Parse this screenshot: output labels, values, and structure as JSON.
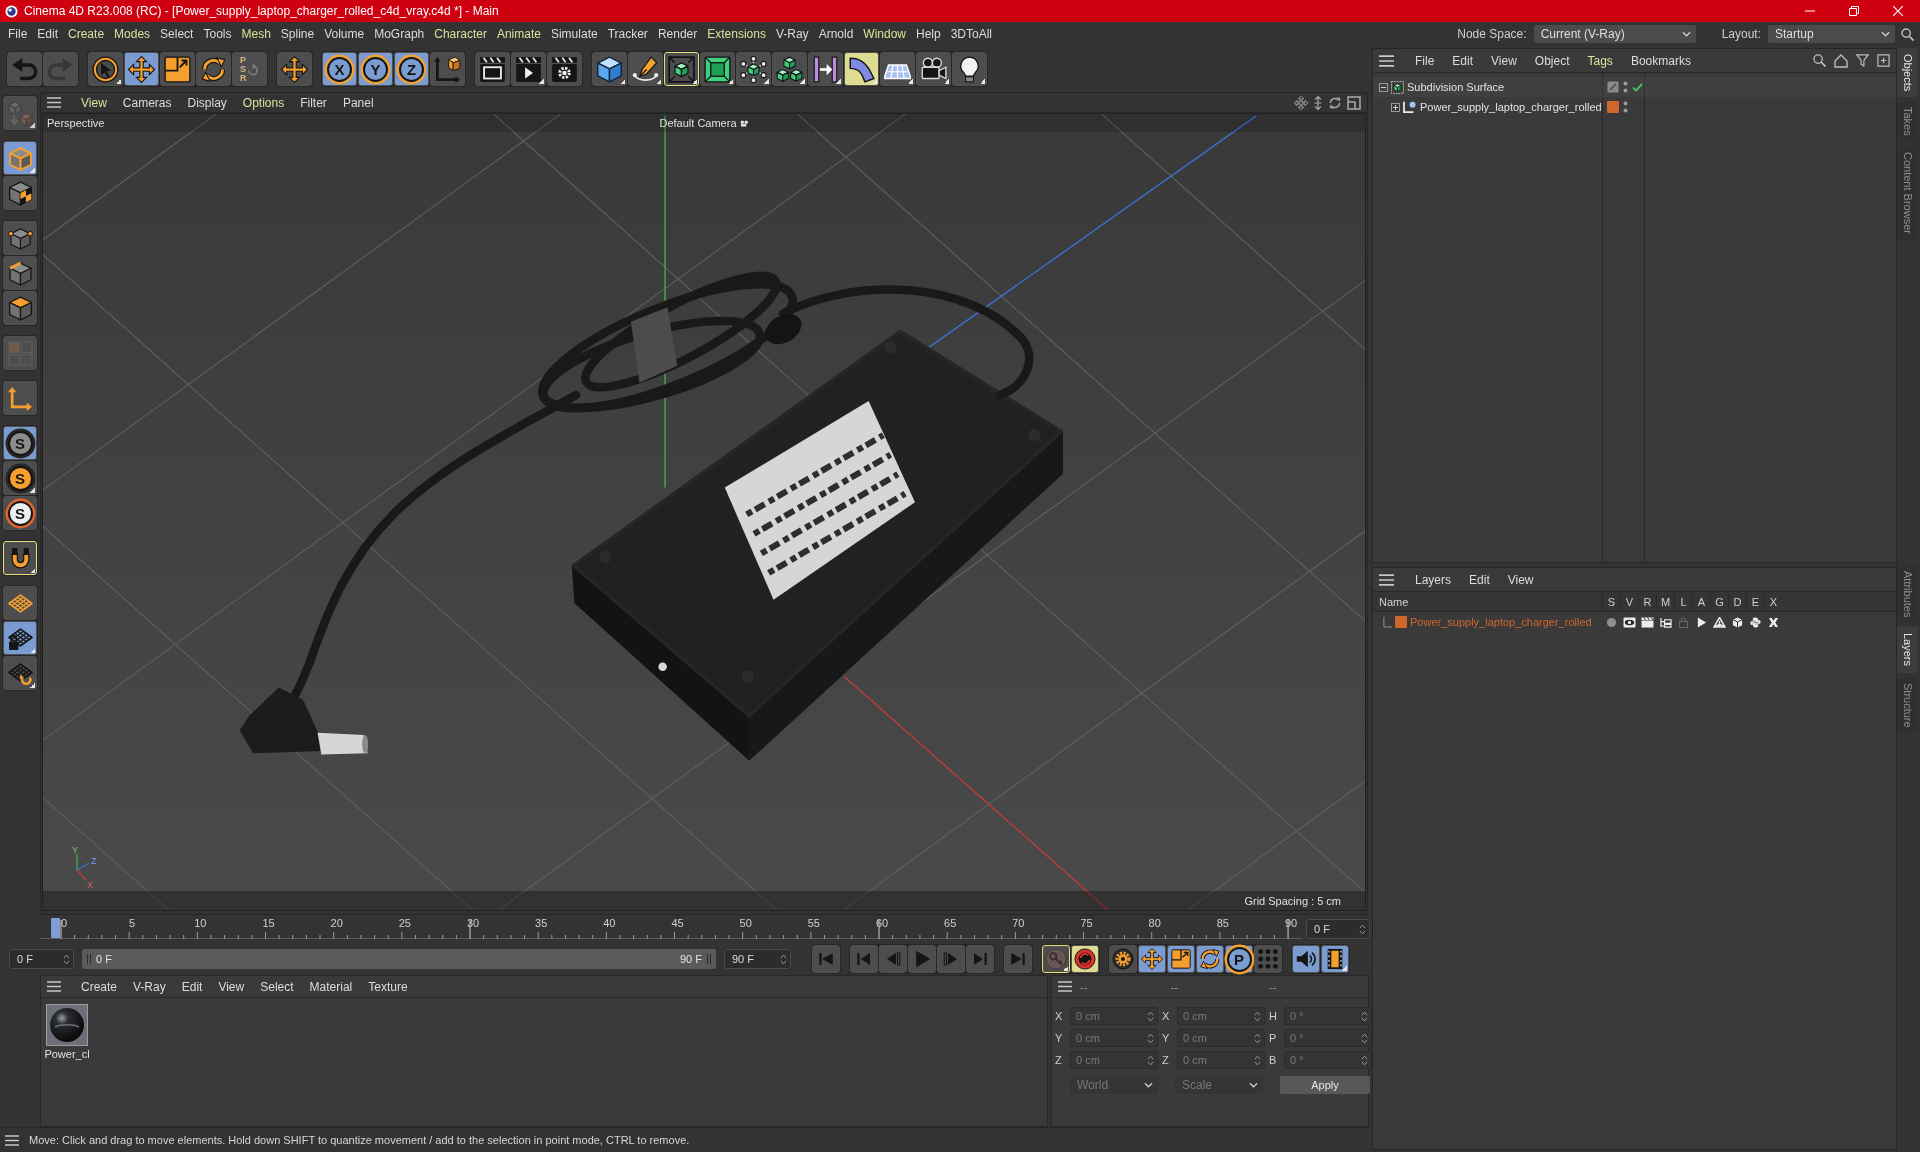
{
  "window": {
    "title": "Cinema 4D R23.008 (RC) - [Power_supply_laptop_charger_rolled_c4d_vray.c4d *] - Main"
  },
  "menu_bar": [
    {
      "label": "File",
      "highlighted": false
    },
    {
      "label": "Edit",
      "highlighted": false
    },
    {
      "label": "Create",
      "highlighted": true
    },
    {
      "label": "Modes",
      "highlighted": true
    },
    {
      "label": "Select",
      "highlighted": false
    },
    {
      "label": "Tools",
      "highlighted": false
    },
    {
      "label": "Mesh",
      "highlighted": true
    },
    {
      "label": "Spline",
      "highlighted": false
    },
    {
      "label": "Volume",
      "highlighted": false
    },
    {
      "label": "MoGraph",
      "highlighted": false
    },
    {
      "label": "Character",
      "highlighted": true
    },
    {
      "label": "Animate",
      "highlighted": true
    },
    {
      "label": "Simulate",
      "highlighted": false
    },
    {
      "label": "Tracker",
      "highlighted": false
    },
    {
      "label": "Render",
      "highlighted": false
    },
    {
      "label": "Extensions",
      "highlighted": true
    },
    {
      "label": "V-Ray",
      "highlighted": false
    },
    {
      "label": "Arnold",
      "highlighted": false
    },
    {
      "label": "Window",
      "highlighted": true
    },
    {
      "label": "Help",
      "highlighted": false
    },
    {
      "label": "3DToAll",
      "highlighted": false
    }
  ],
  "node_space": {
    "label": "Node Space:",
    "value": "Current (V-Ray)"
  },
  "layout": {
    "label": "Layout:",
    "value": "Startup"
  },
  "toolbar": [
    [
      {
        "kind": "undo",
        "selected": false,
        "highlighted": false,
        "lit": false,
        "disabled": false,
        "submenu": false
      },
      {
        "kind": "redo",
        "selected": false,
        "highlighted": false,
        "lit": false,
        "disabled": true,
        "submenu": false
      }
    ],
    [
      {
        "kind": "select",
        "selected": false,
        "highlighted": false,
        "lit": false,
        "disabled": false,
        "submenu": true
      },
      {
        "kind": "move",
        "selected": true,
        "highlighted": false,
        "lit": false,
        "disabled": false,
        "submenu": false
      },
      {
        "kind": "scale",
        "selected": false,
        "highlighted": false,
        "lit": false,
        "disabled": false,
        "submenu": false
      },
      {
        "kind": "rotate",
        "selected": false,
        "highlighted": false,
        "lit": false,
        "disabled": false,
        "submenu": false
      },
      {
        "kind": "psr",
        "glyph": "PSR",
        "selected": false,
        "highlighted": false,
        "lit": false,
        "disabled": true,
        "submenu": false
      }
    ],
    [
      {
        "kind": "transform",
        "selected": false,
        "highlighted": false,
        "lit": false,
        "disabled": false,
        "submenu": false
      }
    ],
    [
      {
        "kind": "axis-lock",
        "glyph": "X",
        "selected": true,
        "highlighted": false,
        "lit": false,
        "disabled": false,
        "submenu": false
      },
      {
        "kind": "axis-lock",
        "glyph": "Y",
        "selected": true,
        "highlighted": false,
        "lit": false,
        "disabled": false,
        "submenu": false
      },
      {
        "kind": "axis-lock",
        "glyph": "Z",
        "selected": true,
        "highlighted": false,
        "lit": false,
        "disabled": false,
        "submenu": false
      },
      {
        "kind": "coord-system",
        "selected": false,
        "highlighted": false,
        "lit": false,
        "disabled": false,
        "submenu": false
      }
    ],
    [
      {
        "kind": "render-view",
        "selected": false,
        "highlighted": false,
        "lit": false,
        "disabled": false,
        "submenu": false
      },
      {
        "kind": "render",
        "selected": false,
        "highlighted": false,
        "lit": false,
        "disabled": false,
        "submenu": true
      },
      {
        "kind": "render-settings",
        "selected": false,
        "highlighted": false,
        "lit": false,
        "disabled": false,
        "submenu": false
      }
    ],
    [
      {
        "kind": "cube",
        "selected": false,
        "highlighted": false,
        "lit": false,
        "disabled": false,
        "submenu": true
      },
      {
        "kind": "pen",
        "selected": false,
        "highlighted": false,
        "lit": false,
        "disabled": false,
        "submenu": true
      },
      {
        "kind": "subdivision",
        "selected": false,
        "highlighted": true,
        "lit": false,
        "disabled": false,
        "submenu": true
      },
      {
        "kind": "extrude",
        "selected": false,
        "highlighted": false,
        "lit": false,
        "disabled": false,
        "submenu": true
      },
      {
        "kind": "cloner",
        "selected": false,
        "highlighted": false,
        "lit": false,
        "disabled": false,
        "submenu": true
      },
      {
        "kind": "array",
        "selected": false,
        "highlighted": false,
        "lit": false,
        "disabled": false,
        "submenu": true
      },
      {
        "kind": "deformer",
        "selected": false,
        "highlighted": false,
        "lit": false,
        "disabled": false,
        "submenu": true
      },
      {
        "kind": "bend",
        "selected": false,
        "highlighted": false,
        "lit": true,
        "disabled": false,
        "submenu": true
      },
      {
        "kind": "floor",
        "selected": false,
        "highlighted": false,
        "lit": false,
        "disabled": false,
        "submenu": true
      },
      {
        "kind": "camera",
        "selected": false,
        "highlighted": false,
        "lit": false,
        "disabled": false,
        "submenu": true
      },
      {
        "kind": "light",
        "selected": false,
        "highlighted": false,
        "lit": false,
        "disabled": false,
        "submenu": true
      }
    ]
  ],
  "tool_palette": [
    [
      {
        "kind": "make-editable",
        "selected": false,
        "highlighted": false,
        "lit": false,
        "disabled": true,
        "submenu": true
      }
    ],
    [
      {
        "kind": "model",
        "selected": true,
        "highlighted": false,
        "lit": false,
        "disabled": false,
        "submenu": true
      },
      {
        "kind": "texture",
        "selected": false,
        "highlighted": false,
        "lit": false,
        "disabled": false,
        "submenu": false
      }
    ],
    [
      {
        "kind": "points",
        "selected": false,
        "highlighted": false,
        "lit": false,
        "disabled": false,
        "submenu": false
      },
      {
        "kind": "edges",
        "selected": false,
        "highlighted": false,
        "lit": false,
        "disabled": false,
        "submenu": false
      },
      {
        "kind": "polygons",
        "selected": false,
        "highlighted": false,
        "lit": false,
        "disabled": false,
        "submenu": false
      }
    ],
    [
      {
        "kind": "uv",
        "selected": false,
        "highlighted": false,
        "lit": false,
        "disabled": true,
        "submenu": false
      }
    ],
    [
      {
        "kind": "axis",
        "selected": false,
        "highlighted": false,
        "lit": false,
        "disabled": false,
        "submenu": false
      }
    ],
    [
      {
        "kind": "snap",
        "glyph": "S",
        "selected": true,
        "highlighted": false,
        "lit": false,
        "disabled": false,
        "submenu": false
      },
      {
        "kind": "snap-enable",
        "glyph": "S",
        "selected": false,
        "highlighted": false,
        "lit": false,
        "disabled": false,
        "submenu": true
      },
      {
        "kind": "snap-quantize",
        "glyph": "S",
        "selected": false,
        "highlighted": false,
        "lit": false,
        "disabled": false,
        "submenu": false
      }
    ],
    [
      {
        "kind": "magnet",
        "selected": false,
        "highlighted": true,
        "lit": false,
        "disabled": false,
        "submenu": true
      }
    ],
    [
      {
        "kind": "workplane",
        "selected": false,
        "highlighted": false,
        "lit": false,
        "disabled": false,
        "submenu": false
      },
      {
        "kind": "workplane-lock",
        "selected": true,
        "highlighted": false,
        "lit": false,
        "disabled": false,
        "submenu": true
      },
      {
        "kind": "workplane-align",
        "selected": false,
        "highlighted": false,
        "lit": false,
        "disabled": false,
        "submenu": true
      }
    ]
  ],
  "viewport": {
    "menu": [
      {
        "label": "View",
        "highlighted": true
      },
      {
        "label": "Cameras",
        "highlighted": false
      },
      {
        "label": "Display",
        "highlighted": false
      },
      {
        "label": "Options",
        "highlighted": true
      },
      {
        "label": "Filter",
        "highlighted": false
      },
      {
        "label": "Panel",
        "highlighted": false
      }
    ],
    "view_name": "Perspective",
    "camera": "Default Camera",
    "axis_labels": [
      "Y",
      "Z",
      "X"
    ],
    "grid_spacing": "Grid Spacing : 5 cm"
  },
  "timeline": {
    "ticks": [
      "0",
      "5",
      "10",
      "15",
      "20",
      "25",
      "30",
      "35",
      "40",
      "45",
      "50",
      "55",
      "60",
      "65",
      "70",
      "75",
      "80",
      "85",
      "90"
    ],
    "level": 0,
    "current_frame": "0 F",
    "start": "0 F",
    "range": {
      "start": "0 F",
      "end": "90 F",
      "level": 1
    },
    "end": "90 F"
  },
  "transport": [
    [
      {
        "kind": "go-start",
        "selected": false,
        "highlighted": false,
        "lit": false,
        "disabled": false,
        "submenu": false
      }
    ],
    [
      {
        "kind": "prev-key",
        "selected": false,
        "highlighted": false,
        "lit": false,
        "disabled": false,
        "submenu": false
      },
      {
        "kind": "prev-frame",
        "selected": false,
        "highlighted": false,
        "lit": false,
        "disabled": false,
        "submenu": false
      },
      {
        "kind": "play",
        "selected": false,
        "highlighted": false,
        "lit": false,
        "disabled": false,
        "submenu": false
      },
      {
        "kind": "next-frame",
        "selected": false,
        "highlighted": false,
        "lit": false,
        "disabled": false,
        "submenu": false
      },
      {
        "kind": "next-key",
        "selected": false,
        "highlighted": false,
        "lit": false,
        "disabled": false,
        "submenu": false
      }
    ],
    [
      {
        "kind": "go-end",
        "selected": false,
        "highlighted": false,
        "lit": false,
        "disabled": false,
        "submenu": false
      }
    ],
    [
      {
        "kind": "record-keys",
        "selected": false,
        "highlighted": true,
        "lit": false,
        "disabled": false,
        "submenu": true
      },
      {
        "kind": "autokey",
        "selected": false,
        "highlighted": false,
        "lit": true,
        "disabled": false,
        "submenu": false
      }
    ],
    [
      {
        "kind": "key-settings",
        "selected": false,
        "highlighted": false,
        "lit": false,
        "disabled": false,
        "submenu": false
      },
      {
        "kind": "key-position",
        "selected": true,
        "highlighted": false,
        "lit": false,
        "disabled": false,
        "submenu": false
      },
      {
        "kind": "key-scale",
        "selected": true,
        "highlighted": false,
        "lit": false,
        "disabled": false,
        "submenu": false
      },
      {
        "kind": "key-rotation",
        "selected": true,
        "highlighted": false,
        "lit": false,
        "disabled": false,
        "submenu": false
      },
      {
        "kind": "key-param",
        "glyph": "P",
        "selected": true,
        "highlighted": false,
        "lit": false,
        "disabled": false,
        "submenu": false
      },
      {
        "kind": "key-points",
        "selected": false,
        "highlighted": false,
        "lit": false,
        "disabled": false,
        "submenu": false
      }
    ],
    [
      {
        "kind": "sound",
        "selected": true,
        "highlighted": false,
        "lit": false,
        "disabled": false,
        "submenu": false
      },
      {
        "kind": "film",
        "selected": true,
        "highlighted": false,
        "lit": false,
        "disabled": false,
        "submenu": true
      }
    ]
  ],
  "material_manager": {
    "menu": [
      {
        "label": "Create",
        "highlighted": false
      },
      {
        "label": "V-Ray",
        "highlighted": false
      },
      {
        "label": "Edit",
        "highlighted": false
      },
      {
        "label": "View",
        "highlighted": false
      },
      {
        "label": "Select",
        "highlighted": false
      },
      {
        "label": "Material",
        "highlighted": false
      },
      {
        "label": "Texture",
        "highlighted": false
      }
    ],
    "materials": [
      {
        "name": "Power_cl",
        "selected": false
      }
    ]
  },
  "coordinates": {
    "disabled": true,
    "headers": [
      "--",
      "--",
      "--"
    ],
    "rows": [
      [
        {
          "axis": "X",
          "value": "0 cm"
        },
        {
          "axis": "X",
          "value": "0 cm"
        },
        {
          "axis": "H",
          "value": "0 °"
        }
      ],
      [
        {
          "axis": "Y",
          "value": "0 cm"
        },
        {
          "axis": "Y",
          "value": "0 cm"
        },
        {
          "axis": "P",
          "value": "0 °"
        }
      ],
      [
        {
          "axis": "Z",
          "value": "0 cm"
        },
        {
          "axis": "Z",
          "value": "0 cm"
        },
        {
          "axis": "B",
          "value": "0 °"
        }
      ]
    ],
    "mode": "World",
    "size_mode": "Scale",
    "apply": "Apply"
  },
  "object_manager": {
    "menu": [
      {
        "label": "File",
        "highlighted": false
      },
      {
        "label": "Edit",
        "highlighted": false
      },
      {
        "label": "View",
        "highlighted": false
      },
      {
        "label": "Object",
        "highlighted": false
      },
      {
        "label": "Tags",
        "highlighted": true
      },
      {
        "label": "Bookmarks",
        "highlighted": false
      }
    ],
    "objects": [
      {
        "name": "Subdivision Surface",
        "kind": "subdivision",
        "expanded": true,
        "checked": true,
        "children": [
          {
            "name": "Power_supply_laptop_charger_rolled",
            "kind": "polygon",
            "expanded": false,
            "checked": false,
            "color": "#d0662c"
          }
        ]
      }
    ]
  },
  "layers_manager": {
    "menu": [
      {
        "label": "Layers",
        "highlighted": false
      },
      {
        "label": "Edit",
        "highlighted": false
      },
      {
        "label": "View",
        "highlighted": false
      }
    ],
    "columns": [
      "Name",
      "S",
      "V",
      "R",
      "M",
      "L",
      "A",
      "G",
      "D",
      "E",
      "X"
    ],
    "layers": [
      {
        "name": "Power_supply_laptop_charger_rolled",
        "color": "#d0662c",
        "selected": false,
        "flags": [
          {
            "on": false
          },
          {
            "on": true
          },
          {
            "on": true
          },
          {
            "on": true
          },
          {
            "on": false
          },
          {
            "on": true
          },
          {
            "on": true
          },
          {
            "on": true
          },
          {
            "on": true
          },
          {
            "on": true
          }
        ]
      }
    ]
  },
  "side_tabs": [
    [
      {
        "label": "Objects",
        "selected": true
      },
      {
        "label": "Takes",
        "selected": false
      },
      {
        "label": "Content Browser",
        "selected": false
      }
    ],
    [
      {
        "label": "Attributes",
        "selected": false
      },
      {
        "label": "Layers",
        "selected": true
      },
      {
        "label": "Structure",
        "selected": false
      }
    ]
  ],
  "status_bar": {
    "text": "Move: Click and drag to move elements. Hold down SHIFT to quantize movement / add to the selection in point mode, CTRL to remove."
  }
}
